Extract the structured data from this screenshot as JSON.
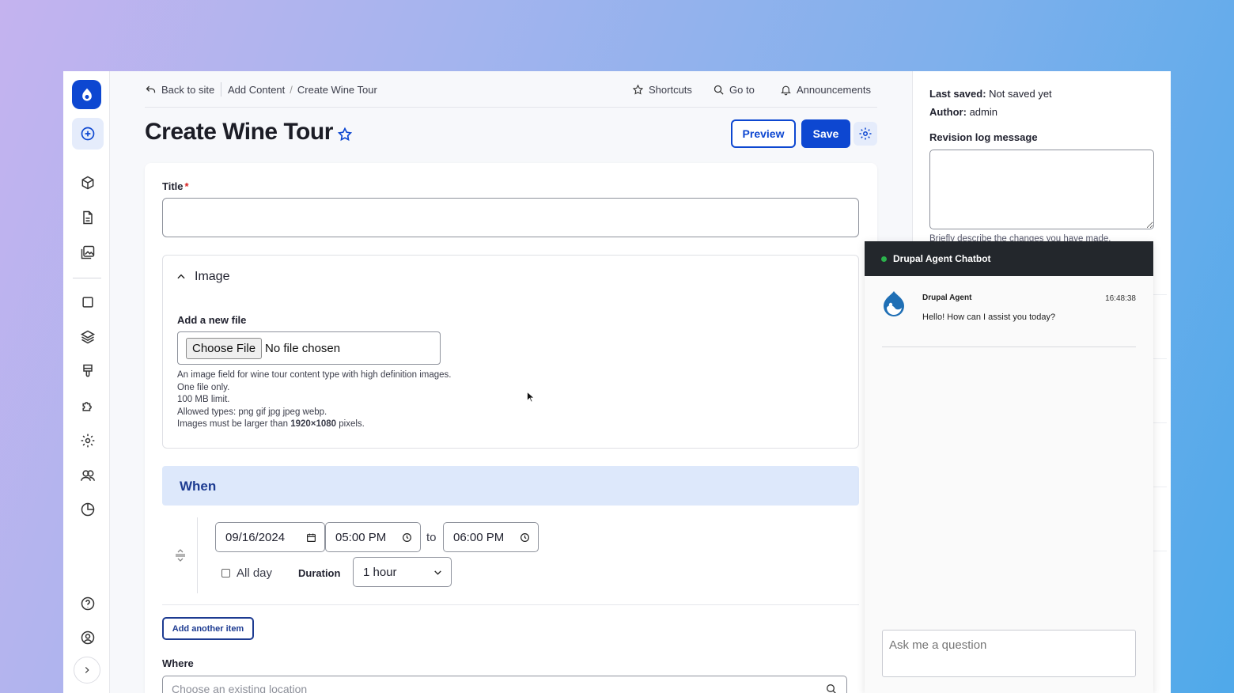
{
  "topbar": {
    "back": "Back to site",
    "crumbs": [
      "Add Content",
      "/",
      "Create Wine Tour"
    ],
    "shortcuts": "Shortcuts",
    "goto": "Go to",
    "announcements": "Announcements"
  },
  "page": {
    "title": "Create Wine Tour",
    "preview": "Preview",
    "save": "Save"
  },
  "form": {
    "title_label": "Title",
    "required_mark": "*",
    "image": {
      "heading": "Image",
      "add_label": "Add a new file",
      "choose_btn": "Choose File",
      "status": "No file chosen",
      "help": [
        "An image field for wine tour content type with high definition images.",
        "One file only.",
        "100 MB limit.",
        "Allowed types: png gif jpg jpeg webp."
      ],
      "help_size_prefix": "Images must be larger than ",
      "help_size_value": "1920×1080",
      "help_size_suffix": " pixels."
    },
    "when": {
      "heading": "When",
      "date": "09/16/2024",
      "start": "05:00 PM",
      "to": "to",
      "end": "06:00 PM",
      "all_day": "All day",
      "duration_label": "Duration",
      "duration_value": "1 hour"
    },
    "add_another": "Add another item",
    "where_label": "Where",
    "where_placeholder": "Choose an existing location"
  },
  "sidebar_panel": {
    "last_saved_label": "Last saved:",
    "last_saved_value": "Not saved yet",
    "author_label": "Author:",
    "author_value": "admin",
    "revision_label": "Revision log message",
    "revision_help": "Briefly describe the changes you have made."
  },
  "chat": {
    "title": "Drupal Agent Chatbot",
    "agent_name": "Drupal Agent",
    "time": "16:48:38",
    "message": "Hello! How can I assist you today?",
    "input_placeholder": "Ask me a question"
  },
  "colors": {
    "primary": "#0d47d1",
    "when_bg": "#dde8fb",
    "chat_header": "#23272c",
    "online": "#2bb24c"
  },
  "icons": [
    "drupal-logo-icon",
    "plus-circle-icon",
    "cube-icon",
    "file-icon",
    "image-gallery-icon",
    "square-icon",
    "layers-icon",
    "brush-icon",
    "puzzle-icon",
    "gear-icon",
    "users-icon",
    "pie-chart-icon",
    "help-icon",
    "user-circle-icon",
    "chevron-right-icon",
    "star-icon",
    "search-icon",
    "bell-icon",
    "back-arrow-icon",
    "calendar-icon",
    "clock-icon",
    "chevron-down-icon",
    "chevron-up-icon",
    "drag-handle-icon"
  ]
}
